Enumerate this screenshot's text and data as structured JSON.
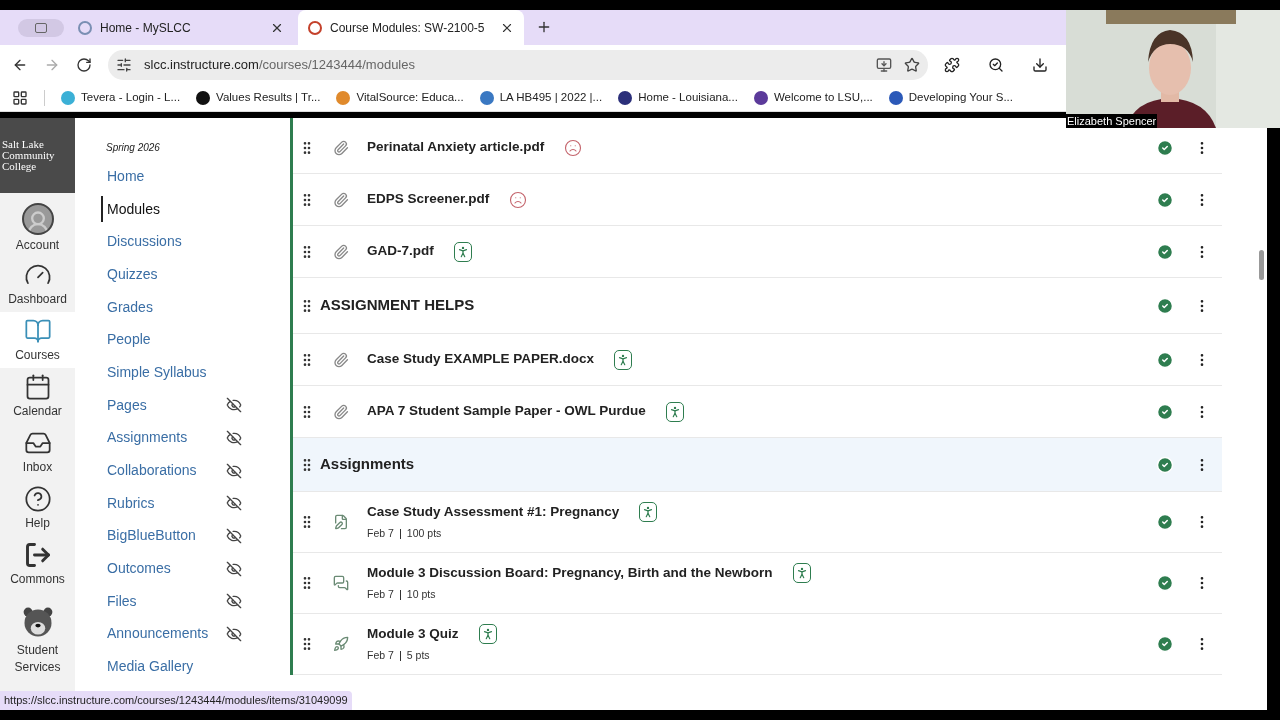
{
  "browser": {
    "tabs": [
      {
        "title": "Home - MySLCC",
        "selected": false
      },
      {
        "title": "Course Modules: SW-2100-5",
        "selected": true
      }
    ],
    "url_host": "slcc.instructure.com",
    "url_path": "/courses/1243444/modules",
    "bookmarks": [
      {
        "label": "Tevera - Login - L..."
      },
      {
        "label": "Values Results | Tr..."
      },
      {
        "label": "VitalSource: Educa..."
      },
      {
        "label": "LA HB495 | 2022 |..."
      },
      {
        "label": "Home - Louisiana..."
      },
      {
        "label": "Welcome to LSU,..."
      },
      {
        "label": "Developing Your S..."
      }
    ]
  },
  "webcam": {
    "name": "Elizabeth Spencer"
  },
  "global_nav": [
    {
      "label": "Account",
      "kind": "account",
      "selected": false
    },
    {
      "label": "Dashboard",
      "kind": "dashboard",
      "selected": false
    },
    {
      "label": "Courses",
      "kind": "courses",
      "selected": true
    },
    {
      "label": "Calendar",
      "kind": "calendar",
      "selected": false
    },
    {
      "label": "Inbox",
      "kind": "inbox",
      "selected": false
    },
    {
      "label": "Help",
      "kind": "help",
      "selected": false
    },
    {
      "label": "Commons",
      "kind": "commons",
      "selected": false
    },
    {
      "label": "Student Services",
      "kind": "services",
      "selected": false
    }
  ],
  "logo": {
    "lines": [
      "Salt Lake",
      "Community",
      "College"
    ]
  },
  "course_nav": {
    "term": "Spring 2026",
    "items": [
      {
        "label": "Home",
        "selected": false,
        "hidden": false
      },
      {
        "label": "Modules",
        "selected": true,
        "hidden": false
      },
      {
        "label": "Discussions",
        "selected": false,
        "hidden": false
      },
      {
        "label": "Quizzes",
        "selected": false,
        "hidden": false
      },
      {
        "label": "Grades",
        "selected": false,
        "hidden": false
      },
      {
        "label": "People",
        "selected": false,
        "hidden": false
      },
      {
        "label": "Simple Syllabus",
        "selected": false,
        "hidden": false
      },
      {
        "label": "Pages",
        "selected": false,
        "hidden": true
      },
      {
        "label": "Assignments",
        "selected": false,
        "hidden": true
      },
      {
        "label": "Collaborations",
        "selected": false,
        "hidden": true
      },
      {
        "label": "Rubrics",
        "selected": false,
        "hidden": true
      },
      {
        "label": "BigBlueButton",
        "selected": false,
        "hidden": true
      },
      {
        "label": "Outcomes",
        "selected": false,
        "hidden": true
      },
      {
        "label": "Files",
        "selected": false,
        "hidden": true
      },
      {
        "label": "Announcements",
        "selected": false,
        "hidden": true
      },
      {
        "label": "Media Gallery",
        "selected": false,
        "hidden": false
      }
    ]
  },
  "modules": [
    {
      "kind": "attachment",
      "title": "Perinatal Anxiety article.pdf",
      "accessibility_issue": true,
      "published": true,
      "highlighted": false
    },
    {
      "kind": "attachment",
      "title": "EDPS Screener.pdf",
      "accessibility_issue": true,
      "published": true,
      "highlighted": false
    },
    {
      "kind": "attachment",
      "title": "GAD-7.pdf",
      "accessibility_issue": false,
      "published": true,
      "highlighted": false
    },
    {
      "kind": "header",
      "title": "ASSIGNMENT HELPS",
      "published": true,
      "highlighted": false
    },
    {
      "kind": "attachment",
      "title": "Case Study EXAMPLE PAPER.docx",
      "accessibility_issue": false,
      "published": true,
      "highlighted": false
    },
    {
      "kind": "attachment",
      "title": "APA 7 Student Sample Paper - OWL Purdue",
      "accessibility_issue": false,
      "published": true,
      "highlighted": false
    },
    {
      "kind": "header",
      "title": "Assignments",
      "published": true,
      "highlighted": true
    },
    {
      "kind": "assignment",
      "title": "Case Study Assessment #1:  Pregnancy",
      "date": "Feb 7",
      "points": "100 pts",
      "accessibility_issue": false,
      "published": true,
      "highlighted": false
    },
    {
      "kind": "discussion",
      "title": "Module 3 Discussion Board: Pregnancy, Birth and the Newborn",
      "date": "Feb 7",
      "points": "10 pts",
      "accessibility_issue": false,
      "published": true,
      "highlighted": false
    },
    {
      "kind": "quiz",
      "title": "Module 3 Quiz",
      "date": "Feb 7",
      "points": "5 pts",
      "accessibility_issue": false,
      "published": true,
      "highlighted": false
    }
  ],
  "status_url": "https://slcc.instructure.com/courses/1243444/modules/items/31049099"
}
